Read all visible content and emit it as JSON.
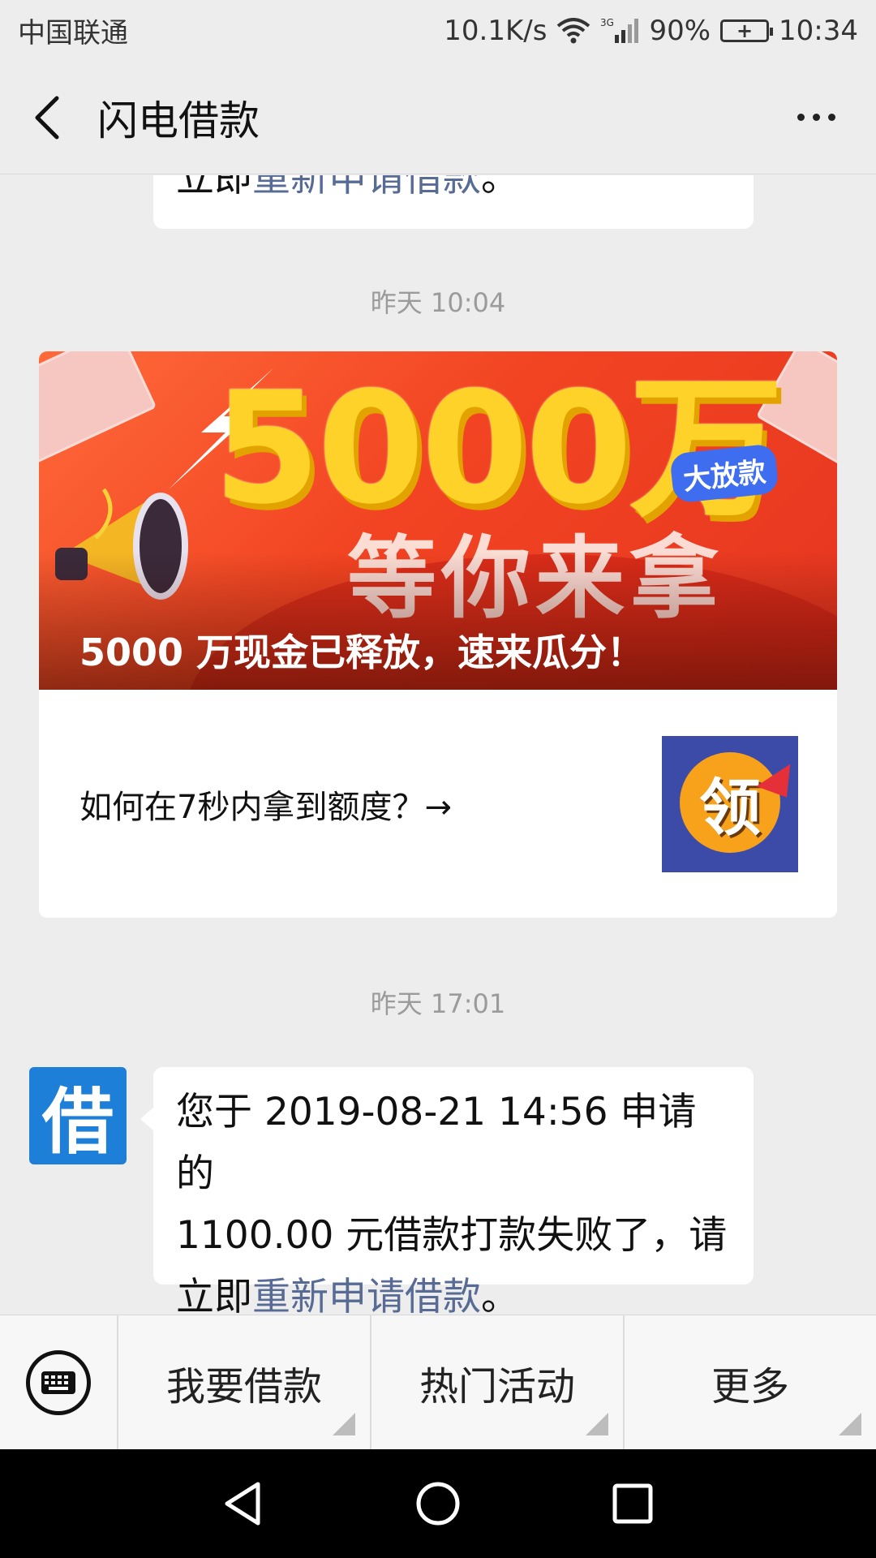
{
  "status_bar": {
    "carrier": "中国联通",
    "speed": "10.1K/s",
    "network": "3G",
    "battery": "90%",
    "time": "10:34"
  },
  "header": {
    "title": "闪电借款"
  },
  "chat": {
    "top_bubble": {
      "text_before": "立即",
      "link": "重新申请借款",
      "text_after": "。"
    },
    "timestamp_1": "昨天 10:04",
    "article": {
      "banner_headline": "5000万",
      "banner_tag": "大放款",
      "banner_sub": "等你来拿",
      "banner_caption": "5000 万现金已释放，速来瓜分！",
      "row_title": "如何在7秒内拿到额度？→",
      "thumb_text": "领"
    },
    "timestamp_2": "昨天 17:01",
    "avatar_text": "借",
    "message": {
      "line1": "您于 2019-08-21 14:56 申请的",
      "line2": "1100.00 元借款打款失败了，请",
      "line3_before": "立即",
      "link": "重新申请借款",
      "line3_after": "。"
    }
  },
  "menu": {
    "items": [
      {
        "label": "我要借款"
      },
      {
        "label": "热门活动"
      },
      {
        "label": "更多"
      }
    ]
  },
  "colors": {
    "link": "#576b95",
    "background": "#ededed",
    "avatar": "#1e7fd8"
  }
}
